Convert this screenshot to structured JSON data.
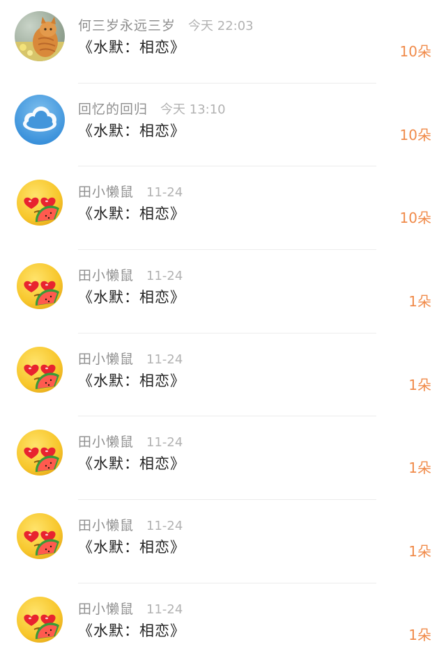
{
  "gifts": [
    {
      "user": "何三岁永远三岁",
      "time": "今天 22:03",
      "song": "《水默：相恋》",
      "count": "10朵",
      "avatar": "cat-photo-avatar"
    },
    {
      "user": "回忆的回归",
      "time": "今天 13:10",
      "song": "《水默：相恋》",
      "count": "10朵",
      "avatar": "cloud-avatar"
    },
    {
      "user": "田小懒鼠",
      "time": "11-24",
      "song": "《水默：相恋》",
      "count": "10朵",
      "avatar": "heart-eyes-emoji-avatar"
    },
    {
      "user": "田小懒鼠",
      "time": "11-24",
      "song": "《水默：相恋》",
      "count": "1朵",
      "avatar": "heart-eyes-emoji-avatar"
    },
    {
      "user": "田小懒鼠",
      "time": "11-24",
      "song": "《水默：相恋》",
      "count": "1朵",
      "avatar": "heart-eyes-emoji-avatar"
    },
    {
      "user": "田小懒鼠",
      "time": "11-24",
      "song": "《水默：相恋》",
      "count": "1朵",
      "avatar": "heart-eyes-emoji-avatar"
    },
    {
      "user": "田小懒鼠",
      "time": "11-24",
      "song": "《水默：相恋》",
      "count": "1朵",
      "avatar": "heart-eyes-emoji-avatar"
    },
    {
      "user": "田小懒鼠",
      "time": "11-24",
      "song": "《水默：相恋》",
      "count": "1朵",
      "avatar": "heart-eyes-emoji-avatar"
    }
  ],
  "colors": {
    "count_accent": "#f08a49",
    "username": "#8e8e8e",
    "timestamp": "#b2b2b2",
    "song_title": "#222222"
  }
}
